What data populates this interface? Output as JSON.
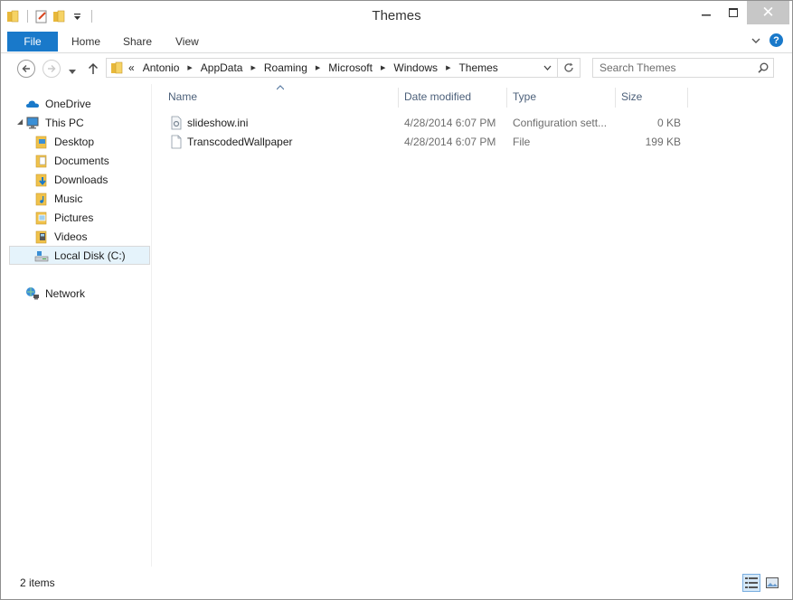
{
  "window": {
    "title": "Themes"
  },
  "quick_access": {
    "icons": [
      "folder-icon",
      "properties-icon",
      "new-folder-icon",
      "customize-qat-icon"
    ]
  },
  "ribbon": {
    "file_tab": "File",
    "tabs": [
      "Home",
      "Share",
      "View"
    ]
  },
  "address_bar": {
    "overflow": "«",
    "breadcrumbs": [
      "Antonio",
      "AppData",
      "Roaming",
      "Microsoft",
      "Windows",
      "Themes"
    ]
  },
  "search": {
    "placeholder": "Search Themes"
  },
  "sidebar": {
    "onedrive": "OneDrive",
    "this_pc": "This PC",
    "items": [
      "Desktop",
      "Documents",
      "Downloads",
      "Music",
      "Pictures",
      "Videos",
      "Local Disk (C:)"
    ],
    "network": "Network"
  },
  "columns": {
    "name": "Name",
    "date": "Date modified",
    "type": "Type",
    "size": "Size"
  },
  "files": [
    {
      "name": "slideshow.ini",
      "date": "4/28/2014 6:07 PM",
      "type": "Configuration sett...",
      "size": "0 KB",
      "icon": "ini-file-icon"
    },
    {
      "name": "TranscodedWallpaper",
      "date": "4/28/2014 6:07 PM",
      "type": "File",
      "size": "199 KB",
      "icon": "file-icon"
    }
  ],
  "status": {
    "items_count": "2 items"
  },
  "colors": {
    "accent": "#1979ca",
    "selection": "#e5f3fb",
    "header_text": "#4c607a"
  }
}
